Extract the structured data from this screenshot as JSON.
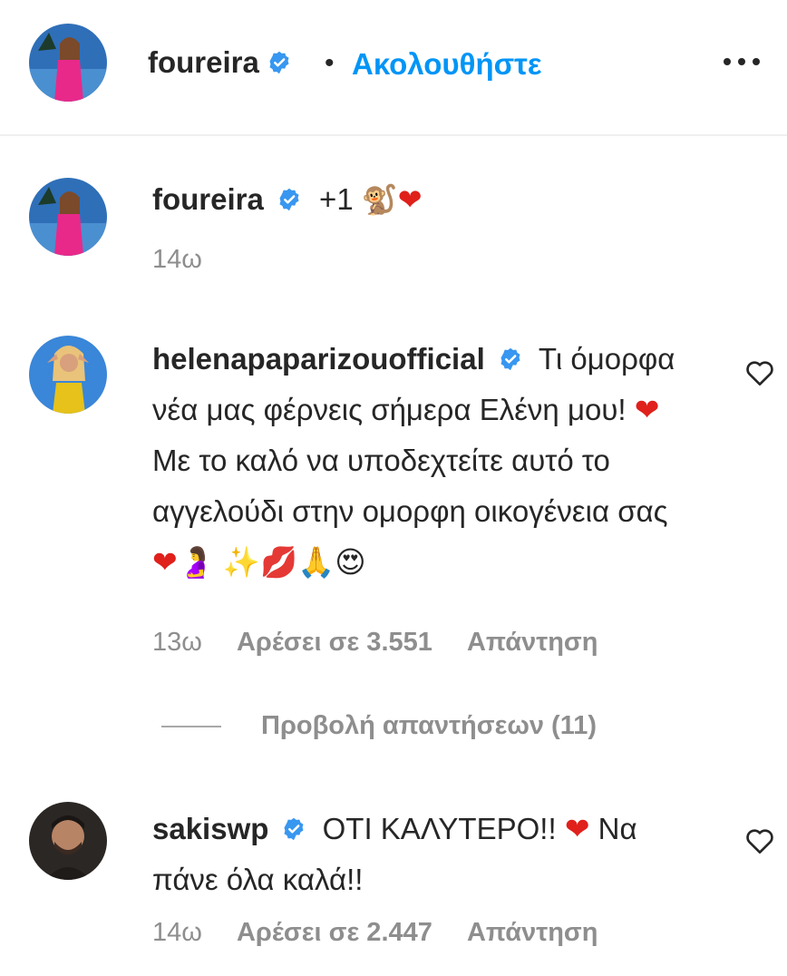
{
  "header": {
    "username": "foureira",
    "separator": "•",
    "follow_label": "Ακολουθήστε",
    "more_label": "•••"
  },
  "comments": [
    {
      "username": "foureira",
      "text": "+1",
      "emojis": [
        "🐒",
        "❤"
      ],
      "time": "14ω"
    },
    {
      "username": "helenapaparizouofficial",
      "text": "Τι όμορφα νέα μας φέρνεις σήμερα Ελένη μου! ❤ Με το καλό να υποδεχτείτε αυτό το αγγελούδι στην ομορφη οικογένεια σας ❤🤰 ✨💋🙏😍",
      "time": "13ω",
      "likes": "Αρέσει σε 3.551",
      "reply": "Απάντηση",
      "view_replies": "Προβολή απαντήσεων (11)"
    },
    {
      "username": "sakiswp",
      "text": "ΟΤΙ ΚΑΛΥΤΕΡΟ!! ❤ Να πάνε όλα καλά!!",
      "time": "14ω",
      "likes": "Αρέσει σε 2.447",
      "reply": "Απάντηση"
    }
  ],
  "colors": {
    "accent": "#0095f6",
    "verified": "#3897f0",
    "heart": "#e0201b",
    "muted": "#8e8e8e"
  },
  "icons": [
    "verified-badge-icon",
    "more-options-icon",
    "heart-outline-icon"
  ]
}
